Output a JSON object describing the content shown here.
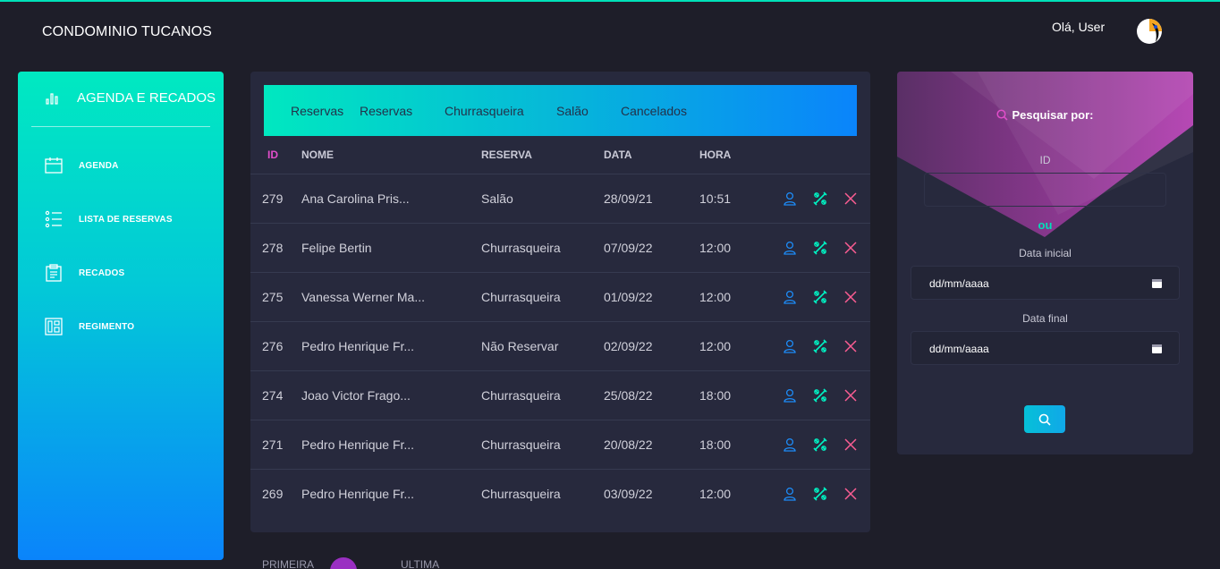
{
  "header": {
    "brand": "CONDOMINIO TUCANOS",
    "greeting": "Olá, User"
  },
  "sidebar": {
    "title": "AGENDA E RECADOS",
    "items": [
      {
        "label": "AGENDA",
        "icon": "calendar-icon"
      },
      {
        "label": "LISTA DE RESERVAS",
        "icon": "list-icon"
      },
      {
        "label": "RECADOS",
        "icon": "clipboard-icon"
      },
      {
        "label": "REGIMENTO",
        "icon": "building-icon"
      }
    ]
  },
  "tabs": [
    "Reservas",
    "Reservas",
    "Churrasqueira",
    "Salão",
    "Cancelados"
  ],
  "table": {
    "headers": [
      "ID",
      "NOME",
      "RESERVA",
      "DATA",
      "HORA"
    ],
    "rows": [
      {
        "id": "279",
        "nome": "Ana Carolina Pris...",
        "reserva": "Salão",
        "data": "28/09/21",
        "hora": "10:51"
      },
      {
        "id": "278",
        "nome": "Felipe Bertin",
        "reserva": "Churrasqueira",
        "data": "07/09/22",
        "hora": "12:00"
      },
      {
        "id": "275",
        "nome": "Vanessa Werner Ma...",
        "reserva": "Churrasqueira",
        "data": "01/09/22",
        "hora": "12:00"
      },
      {
        "id": "276",
        "nome": "Pedro Henrique Fr...",
        "reserva": "Não Reservar",
        "data": "02/09/22",
        "hora": "12:00"
      },
      {
        "id": "274",
        "nome": "Joao Victor Frago...",
        "reserva": "Churrasqueira",
        "data": "25/08/22",
        "hora": "18:00"
      },
      {
        "id": "271",
        "nome": "Pedro Henrique Fr...",
        "reserva": "Churrasqueira",
        "data": "20/08/22",
        "hora": "18:00"
      },
      {
        "id": "269",
        "nome": "Pedro Henrique Fr...",
        "reserva": "Churrasqueira",
        "data": "03/09/22",
        "hora": "12:00"
      }
    ],
    "row_actions": [
      "user-icon",
      "tools-icon",
      "close-icon"
    ]
  },
  "pagination": {
    "first": "PRIMEIRA",
    "last": "ULTIMA"
  },
  "search": {
    "title": "Pesquisar por:",
    "id_label": "ID",
    "id_value": "",
    "or_label": "ou",
    "start_label": "Data inicial",
    "start_placeholder": "dd/mm/aaaa",
    "end_label": "Data final",
    "end_placeholder": "dd/mm/aaaa"
  },
  "colors": {
    "accent_teal": "#00e0b8",
    "accent_blue": "#0a84fb",
    "accent_pink": "#e14eca",
    "panel": "#27293d",
    "background": "#1e1e29"
  }
}
